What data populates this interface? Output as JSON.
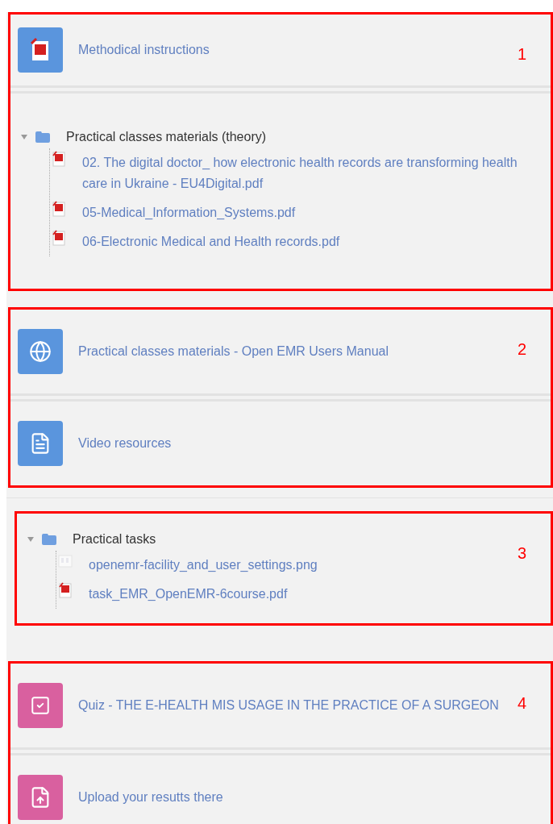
{
  "groups": [
    {
      "number": "1",
      "items": [
        {
          "kind": "pdf",
          "title": "Methodical instructions"
        },
        {
          "kind": "folder",
          "title": "Practical classes materials (theory)",
          "expanded": true,
          "files": [
            {
              "kind": "pdf",
              "name": "02. The digital doctor_ how electronic health records are transforming health care in Ukraine - EU4Digital.pdf"
            },
            {
              "kind": "pdf",
              "name": "05-Medical_Information_Systems.pdf"
            },
            {
              "kind": "pdf",
              "name": "06-Electronic Medical and Health records.pdf"
            }
          ]
        }
      ]
    },
    {
      "number": "2",
      "items": [
        {
          "kind": "url",
          "title": "Practical classes materials - Open EMR Users Manual"
        },
        {
          "kind": "page",
          "title": "Video resources"
        }
      ]
    },
    {
      "number": "3",
      "items": [
        {
          "kind": "folder",
          "title": "Practical tasks",
          "expanded": true,
          "files": [
            {
              "kind": "image",
              "name": "openemr-facility_and_user_settings.png"
            },
            {
              "kind": "pdf",
              "name": "task_EMR_OpenEMR-6course.pdf"
            }
          ]
        }
      ]
    },
    {
      "number": "4",
      "items": [
        {
          "kind": "quiz",
          "title": "Quiz - THE E-HEALTH MIS USAGE IN THE PRACTICE OF A SURGEON"
        },
        {
          "kind": "assign",
          "title": "Upload your resutts there"
        }
      ]
    }
  ]
}
